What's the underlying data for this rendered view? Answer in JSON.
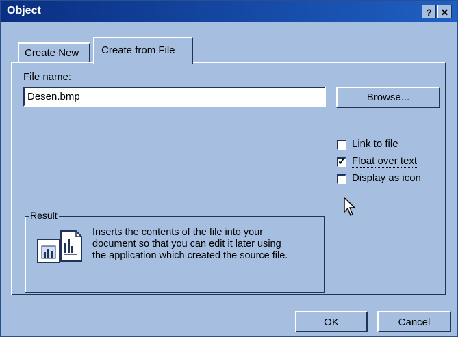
{
  "window": {
    "title": "Object"
  },
  "titlebar_buttons": {
    "help": "?",
    "close": "✕"
  },
  "tabs": [
    {
      "label": "Create New",
      "active": false
    },
    {
      "label": "Create from File",
      "active": true
    }
  ],
  "file": {
    "label": "File name:",
    "value": "Desen.bmp"
  },
  "buttons": {
    "browse": "Browse...",
    "ok": "OK",
    "cancel": "Cancel"
  },
  "options": [
    {
      "label": "Link to file",
      "checked": false
    },
    {
      "label": "Float over text",
      "checked": true
    },
    {
      "label": "Display as icon",
      "checked": false
    }
  ],
  "result": {
    "label": "Result",
    "lines": [
      "Inserts the contents of the file into your",
      "document so that you can edit it later using",
      "the application which created the source file."
    ]
  },
  "colors": {
    "dialog_bg": "#a6bfe1",
    "titlebar": "#0a2f82",
    "border_dark": "#20345a"
  },
  "icons": [
    "help-icon",
    "close-icon",
    "checkmark-icon",
    "document-icon",
    "mouse-pointer-icon"
  ]
}
